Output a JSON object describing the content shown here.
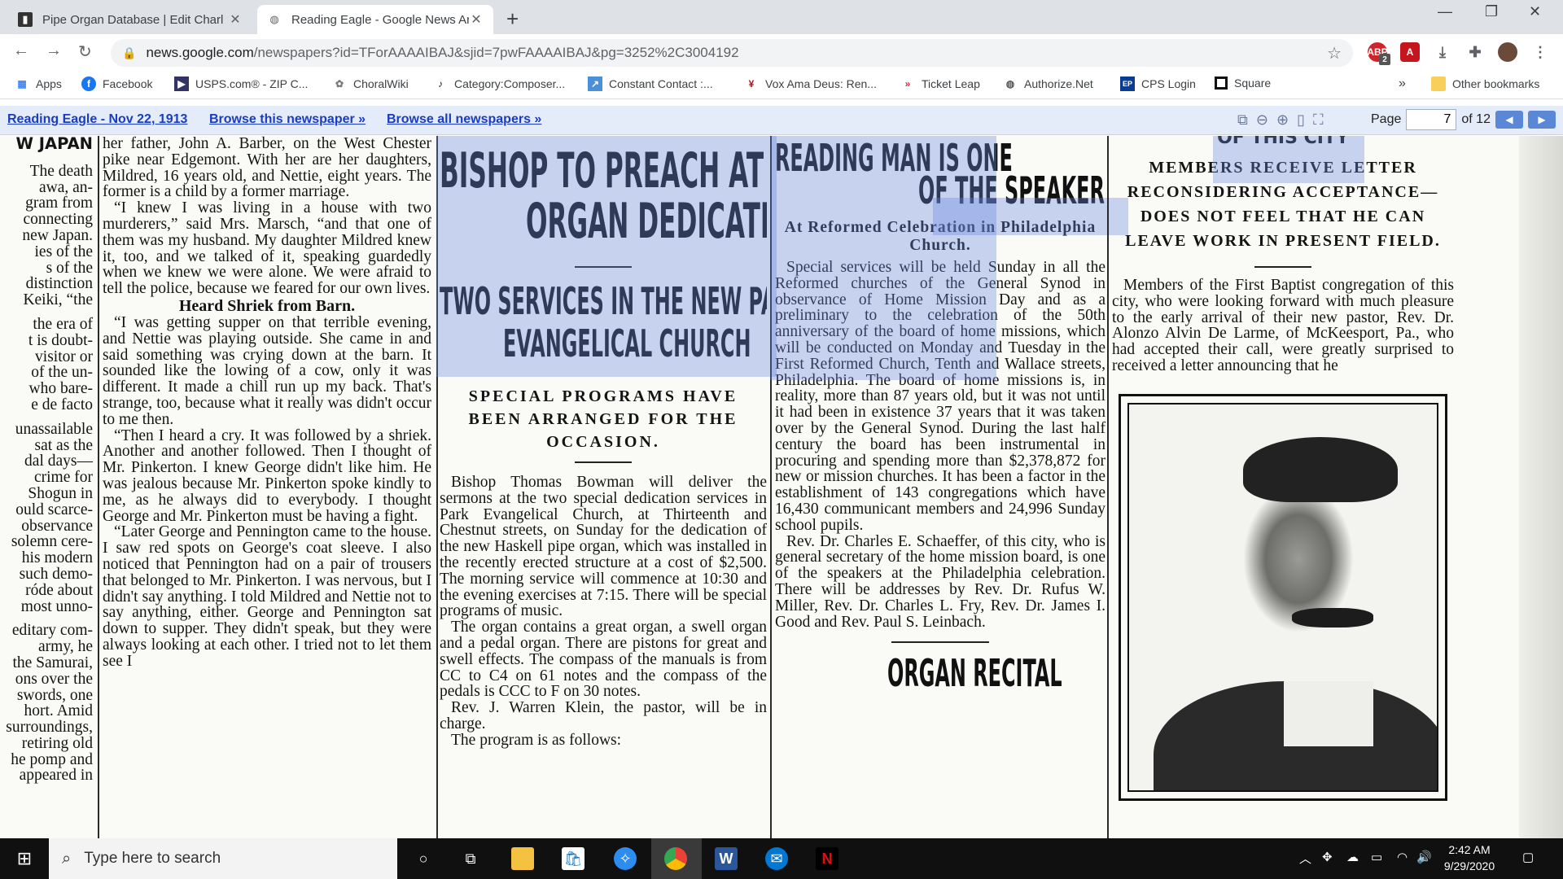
{
  "browser": {
    "tabs": [
      {
        "title": "Pipe Organ Database | Edit Charl",
        "active": false
      },
      {
        "title": "Reading Eagle - Google News Ar",
        "active": true
      }
    ],
    "new_tab_symbol": "+",
    "url_host": "news.google.com",
    "url_path": "/newspapers?id=TForAAAAIBAJ&sjid=7pwFAAAAIBAJ&pg=3252%2C3004192",
    "extension_badge": "2"
  },
  "bookmarks": {
    "items": [
      {
        "label": "Apps",
        "icon": "apps-grid-icon",
        "color": "#4285f4"
      },
      {
        "label": "Facebook",
        "icon": "facebook-icon",
        "color": "#1877f2"
      },
      {
        "label": "USPS.com® - ZIP C...",
        "icon": "usps-icon",
        "color": "#333366"
      },
      {
        "label": "ChoralWiki",
        "icon": "choralwiki-icon",
        "color": "#777777"
      },
      {
        "label": "Category:Composer...",
        "icon": "wiki-icon",
        "color": "#222222"
      },
      {
        "label": "Constant Contact :...",
        "icon": "constant-contact-icon",
        "color": "#4a90d9"
      },
      {
        "label": "Vox Ama Deus: Ren...",
        "icon": "vox-ama-deus-icon",
        "color": "#b5121b"
      },
      {
        "label": "Ticket Leap",
        "icon": "ticketleap-icon",
        "color": "#e0234e"
      },
      {
        "label": "Authorize.Net",
        "icon": "authorize-net-icon",
        "color": "#555555"
      },
      {
        "label": "CPS Login",
        "icon": "cps-icon",
        "color": "#0a3d91"
      },
      {
        "label": "Square",
        "icon": "square-icon",
        "color": "#111111"
      }
    ],
    "overflow": "»",
    "other": "Other bookmarks"
  },
  "newsbar": {
    "issue_link": "Reading Eagle - Nov 22, 1913",
    "browse_paper": "Browse this newspaper »",
    "browse_all": "Browse all newspapers »",
    "page_label": "Page",
    "page_value": "7",
    "page_total": "of 12"
  },
  "article_left_edge": {
    "lines": [
      "W JAPAN",
      "The death",
      "awa, an-",
      "gram from",
      "connecting",
      "new Japan.",
      "ies of the",
      "s of the",
      "distinction",
      "Keiki, “the",
      "the era of",
      "t is doubt-",
      "visitor or",
      "of the un-",
      "who bare-",
      "e de facto",
      "unassailable",
      "sat as the",
      "dal days—",
      "crime for",
      "Shogun in",
      "ould scarce-",
      "observance",
      "solemn cere-",
      "his modern",
      "such demo-",
      "róde about",
      "most unno-",
      "editary com-",
      "army, he",
      "the Samurai,",
      "ons over the",
      "swords, one",
      "hort. Amid",
      "surroundings,",
      "retiring old",
      "he pomp and",
      "appeared in"
    ]
  },
  "article_murder": {
    "para1": "her father, John A. Barber, on the West Chester pike near Edgemont. With her are her daughters, Mildred, 16 years old, and Nettie, eight years. The former is a child by a former marriage.",
    "para2": "“I knew I was living in a house with two murderers,” said Mrs. Marsch, “and that one of them was my husband. My daughter Mildred knew it, too, and we talked of it, speaking guardedly when we knew we were alone. We were afraid to tell the police, because we feared for our own lives.",
    "subhead": "Heard Shriek from Barn.",
    "para3": "“I was getting supper on that terrible evening, and Nettie was playing outside. She came in and said something was crying down at the barn. It sounded like the lowing of a cow, only it was different. It made a chill run up my back. That's strange, too, because what it really was didn't occur to me then.",
    "para4": "“Then I heard a cry. It was followed by a shriek. Another and another followed. Then I thought of Mr. Pinkerton. I knew George didn't like him. He was jealous because Mr. Pinkerton spoke kindly to me, as he always did to everybody. I thought George and Mr. Pinkerton must be having a fight.",
    "para5": "“Later George and Pennington came to the house. I saw red spots on George's coat sleeve. I also noticed that Pennington had on a pair of trousers that belonged to Mr. Pinkerton. I was nervous, but I didn't say anything. I told Mildred and Nettie not to say anything, either. George and Pennington sat down to supper. They didn't speak, but they were always looking at each other. I tried not to let them see I"
  },
  "article_bishop": {
    "headline1": "BISHOP TO PREACH AT",
    "headline2": "ORGAN DEDICATION",
    "deck1": "TWO SERVICES IN THE NEW PARK",
    "deck2": "EVANGELICAL CHURCH",
    "subdeck": "SPECIAL PROGRAMS HAVE BEEN ARRANGED FOR THE OCCASION.",
    "para1": "Bishop Thomas Bowman will deliver the sermons at the two special dedication services in Park Evangelical Church, at Thirteenth and Chestnut streets, on Sunday for the dedication of the new Haskell pipe organ, which was installed in the recently erected structure at a cost of $2,500. The morning service will commence at 10:30 and the evening exercises at 7:15. There will be special programs of music.",
    "para2": "The organ contains a great organ, a swell organ and a pedal organ. There are pistons for great and swell effects. The compass of the manuals is from CC to C4 on 61 notes and the compass of the pedals is CCC to F on 30 notes.",
    "para3": "Rev. J. Warren Klein, the pastor, will be in charge.",
    "para4": "The program is as follows:"
  },
  "article_speakers": {
    "headline1": "READING MAN IS ONE",
    "headline2": "OF THE SPEAKERS",
    "subdeck": "At Reformed Celebration in Philadelphia Church.",
    "para1": "Special services will be held Sunday in all the Reformed churches of the General Synod in observance of Home Mission Day and as a preliminary to the celebration of the 50th anniversary of the board of home missions, which will be conducted on Monday and Tuesday in the First Reformed Church, Tenth and Wallace streets, Philadelphia. The board of home missions is, in reality, more than 87 years old, but it was not until it had been in existence 37 years that it was taken over by the General Synod. During the last half century the board has been instrumental in procuring and spending more than $2,378,872 for new or mission churches. It has been a factor in the establishment of 143 congregations which have 16,430 communicant members and 24,996 Sunday school pupils.",
    "para2": "Rev. Dr. Charles E. Schaeffer, of this city, who is general secretary of the home mission board, is one of the speakers at the Philadelphia celebration. There will be addresses by Rev. Dr. Rufus W. Miller, Rev. Dr. Charles L. Fry, Rev. Dr. James I. Good and Rev. Paul S. Leinbach.",
    "next_headline": "ORGAN RECITAL"
  },
  "article_baptist": {
    "top_fragment": "OF THIS CITY",
    "subdeck": "MEMBERS RECEIVE LETTER RECONSIDERING ACCEPTANCE—DOES NOT FEEL THAT HE CAN LEAVE WORK IN PRESENT FIELD.",
    "para1": "Members of the First Baptist congregation of this city, who were looking forward with much pleasure to the early arrival of their new pastor, Rev. Dr. Alonzo Alvin De Larme, of McKeesport, Pa., who had accepted their call, were greatly surprised to received a letter announcing that he"
  },
  "taskbar": {
    "search_placeholder": "Type here to search",
    "time": "2:42 AM",
    "date": "9/29/2020"
  }
}
